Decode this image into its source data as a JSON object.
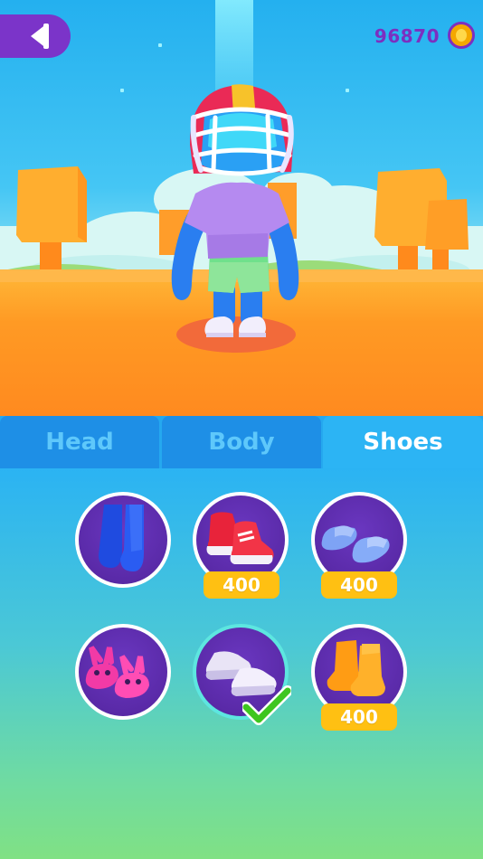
{
  "header": {
    "coin_count": "96870"
  },
  "tabs": [
    {
      "label": "Head",
      "active": false
    },
    {
      "label": "Body",
      "active": false
    },
    {
      "label": "Shoes",
      "active": true
    }
  ],
  "items": [
    {
      "name": "blue-boots",
      "price": "",
      "selected": false
    },
    {
      "name": "red-sneakers",
      "price": "400",
      "selected": false
    },
    {
      "name": "blue-slides",
      "price": "400",
      "selected": false
    },
    {
      "name": "bunny-slippers",
      "price": "",
      "selected": false
    },
    {
      "name": "white-sneakers",
      "price": "",
      "selected": true
    },
    {
      "name": "orange-boots",
      "price": "400",
      "selected": false
    }
  ],
  "colors": {
    "accent_purple": "#7b34c9",
    "price_badge": "#ffc012",
    "check_green": "#3ec61f"
  }
}
